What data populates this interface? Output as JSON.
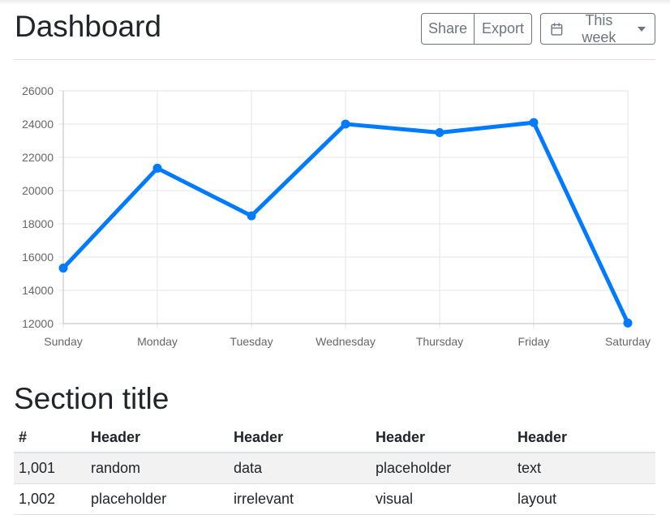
{
  "header": {
    "title": "Dashboard",
    "share_label": "Share",
    "export_label": "Export",
    "range_label": "This week",
    "range_icon": "calendar-icon"
  },
  "colors": {
    "line": "#007bff",
    "button_border": "#6c757d",
    "grid": "#e6e6e6"
  },
  "chart_data": {
    "type": "line",
    "categories": [
      "Sunday",
      "Monday",
      "Tuesday",
      "Wednesday",
      "Thursday",
      "Friday",
      "Saturday"
    ],
    "values": [
      15339,
      21345,
      18483,
      24003,
      23489,
      24092,
      12034
    ],
    "ylim": [
      12000,
      26000
    ],
    "yticks": [
      12000,
      14000,
      16000,
      18000,
      20000,
      22000,
      24000,
      26000
    ],
    "grid": true,
    "legend": "none"
  },
  "section": {
    "title": "Section title"
  },
  "table": {
    "headers": [
      "#",
      "Header",
      "Header",
      "Header",
      "Header"
    ],
    "rows": [
      [
        "1,001",
        "random",
        "data",
        "placeholder",
        "text"
      ],
      [
        "1,002",
        "placeholder",
        "irrelevant",
        "visual",
        "layout"
      ]
    ]
  }
}
